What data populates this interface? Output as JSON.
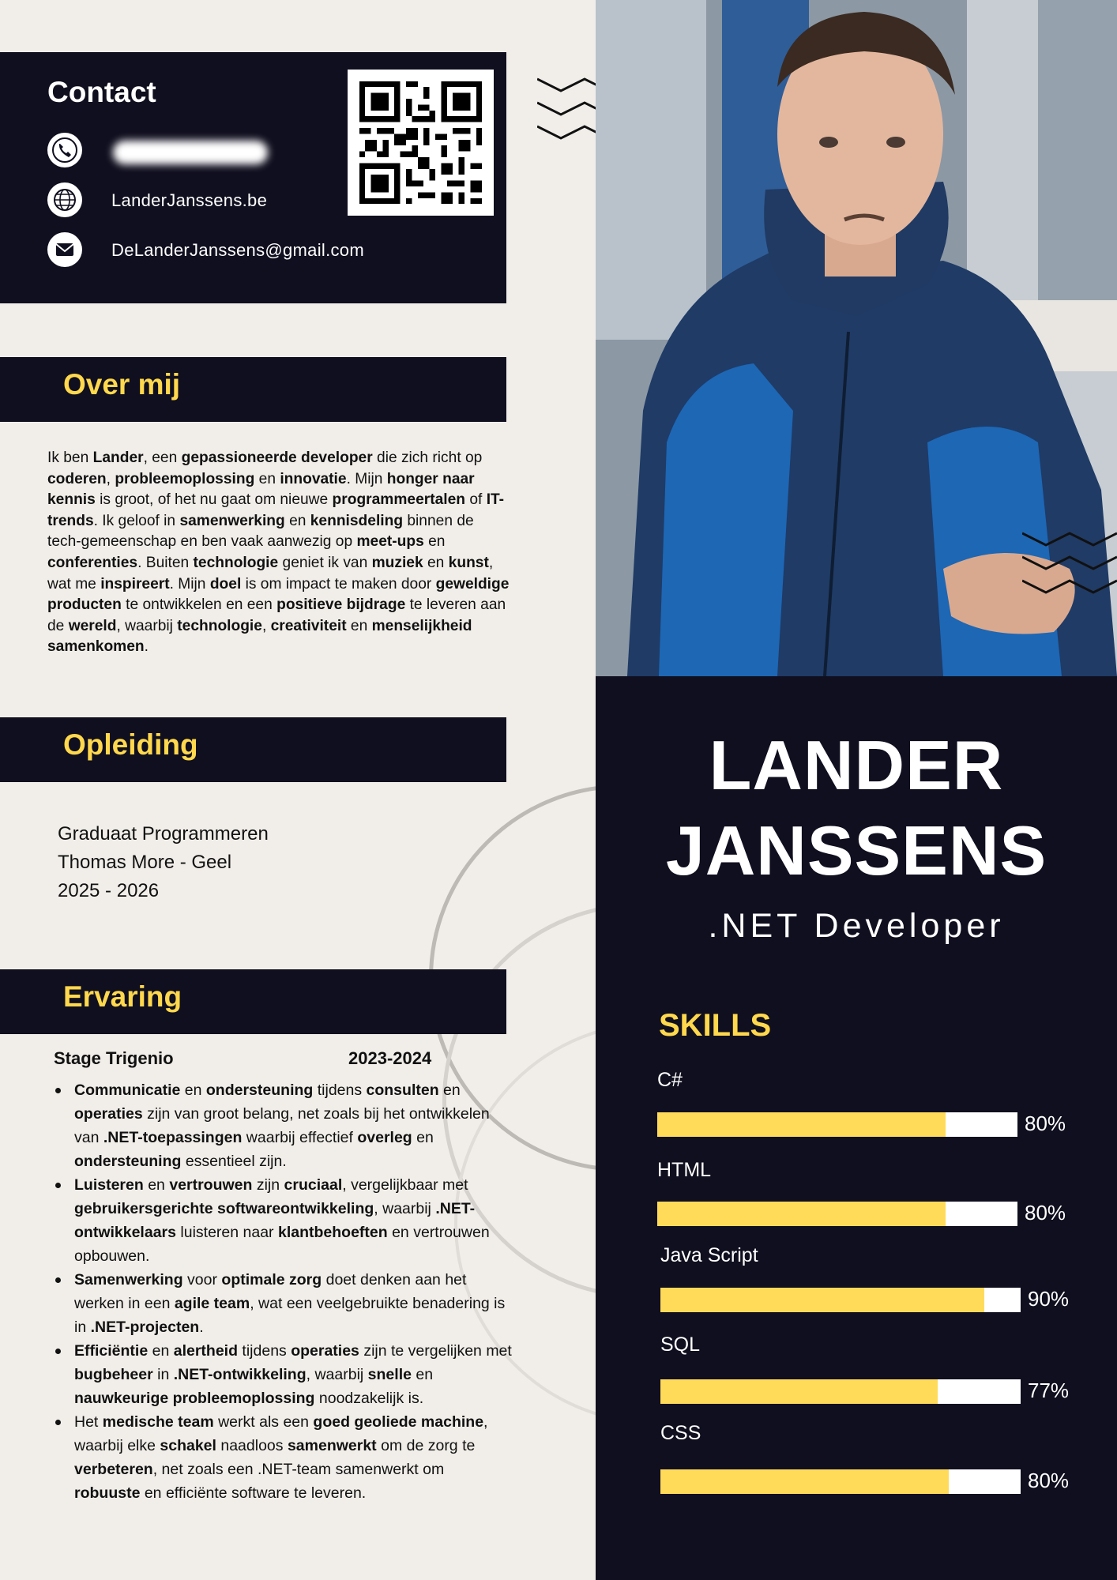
{
  "contact": {
    "title": "Contact",
    "website": "LanderJanssens.be",
    "email": "DeLanderJanssens@gmail.com"
  },
  "about": {
    "title": "Over mij",
    "text_parts": [
      {
        "t": "Ik ben ",
        "b": false
      },
      {
        "t": "Lander",
        "b": true
      },
      {
        "t": ", een ",
        "b": false
      },
      {
        "t": "gepassioneerde developer",
        "b": true
      },
      {
        "t": " die zich richt op ",
        "b": false
      },
      {
        "t": "coderen",
        "b": true
      },
      {
        "t": ", ",
        "b": false
      },
      {
        "t": "probleemoplossing",
        "b": true
      },
      {
        "t": " en ",
        "b": false
      },
      {
        "t": "innovatie",
        "b": true
      },
      {
        "t": ". Mijn ",
        "b": false
      },
      {
        "t": "honger naar kennis",
        "b": true
      },
      {
        "t": " is groot, of het nu gaat om nieuwe ",
        "b": false
      },
      {
        "t": "programmeertalen",
        "b": true
      },
      {
        "t": " of ",
        "b": false
      },
      {
        "t": "IT-trends",
        "b": true
      },
      {
        "t": ". Ik geloof in ",
        "b": false
      },
      {
        "t": "samenwerking",
        "b": true
      },
      {
        "t": " en ",
        "b": false
      },
      {
        "t": "kennisdeling",
        "b": true
      },
      {
        "t": " binnen de tech-gemeenschap en ben vaak aanwezig op ",
        "b": false
      },
      {
        "t": "meet-ups",
        "b": true
      },
      {
        "t": " en ",
        "b": false
      },
      {
        "t": "conferenties",
        "b": true
      },
      {
        "t": ". Buiten ",
        "b": false
      },
      {
        "t": "technologie",
        "b": true
      },
      {
        "t": " geniet ik van ",
        "b": false
      },
      {
        "t": "muziek",
        "b": true
      },
      {
        "t": " en ",
        "b": false
      },
      {
        "t": "kunst",
        "b": true
      },
      {
        "t": ", wat me ",
        "b": false
      },
      {
        "t": "inspireert",
        "b": true
      },
      {
        "t": ". Mijn ",
        "b": false
      },
      {
        "t": "doel",
        "b": true
      },
      {
        "t": " is om impact te maken door ",
        "b": false
      },
      {
        "t": "geweldige producten",
        "b": true
      },
      {
        "t": " te ontwikkelen en een ",
        "b": false
      },
      {
        "t": "positieve bijdrage",
        "b": true
      },
      {
        "t": " te leveren aan de ",
        "b": false
      },
      {
        "t": "wereld",
        "b": true
      },
      {
        "t": ", waarbij ",
        "b": false
      },
      {
        "t": "technologie",
        "b": true
      },
      {
        "t": ", ",
        "b": false
      },
      {
        "t": "creativiteit",
        "b": true
      },
      {
        "t": " en ",
        "b": false
      },
      {
        "t": "menselijkheid samenkomen",
        "b": true
      },
      {
        "t": ".",
        "b": false
      }
    ]
  },
  "education": {
    "title": "Opleiding",
    "program": "Graduaat Programmeren",
    "school": "Thomas More - Geel",
    "years": "2025 - 2026"
  },
  "experience": {
    "title": "Ervaring",
    "role": "Stage Trigenio",
    "years": "2023-2024",
    "bullets": [
      [
        {
          "t": "Communicatie",
          "b": true
        },
        {
          "t": " en ",
          "b": false
        },
        {
          "t": "ondersteuning",
          "b": true
        },
        {
          "t": " tijdens ",
          "b": false
        },
        {
          "t": "consulten",
          "b": true
        },
        {
          "t": " en ",
          "b": false
        },
        {
          "t": "operaties",
          "b": true
        },
        {
          "t": " zijn van groot belang, net zoals bij het ontwikkelen van ",
          "b": false
        },
        {
          "t": ".NET-toepassingen",
          "b": true
        },
        {
          "t": " waarbij effectief ",
          "b": false
        },
        {
          "t": "overleg",
          "b": true
        },
        {
          "t": " en ",
          "b": false
        },
        {
          "t": "ondersteuning",
          "b": true
        },
        {
          "t": " essentieel zijn.",
          "b": false
        }
      ],
      [
        {
          "t": "Luisteren",
          "b": true
        },
        {
          "t": " en ",
          "b": false
        },
        {
          "t": "vertrouwen",
          "b": true
        },
        {
          "t": " zijn ",
          "b": false
        },
        {
          "t": "cruciaal",
          "b": true
        },
        {
          "t": ", vergelijkbaar met ",
          "b": false
        },
        {
          "t": "gebruikersgerichte softwareontwikkeling",
          "b": true
        },
        {
          "t": ", waarbij ",
          "b": false
        },
        {
          "t": ".NET-ontwikkelaars",
          "b": true
        },
        {
          "t": " luisteren naar ",
          "b": false
        },
        {
          "t": "klantbehoeften",
          "b": true
        },
        {
          "t": " en vertrouwen opbouwen.",
          "b": false
        }
      ],
      [
        {
          "t": "Samenwerking",
          "b": true
        },
        {
          "t": " voor ",
          "b": false
        },
        {
          "t": "optimale zorg",
          "b": true
        },
        {
          "t": " doet denken aan het werken in een ",
          "b": false
        },
        {
          "t": "agile team",
          "b": true
        },
        {
          "t": ", wat een veelgebruikte benadering is in ",
          "b": false
        },
        {
          "t": ".NET-projecten",
          "b": true
        },
        {
          "t": ".",
          "b": false
        }
      ],
      [
        {
          "t": "Efficiëntie",
          "b": true
        },
        {
          "t": " en ",
          "b": false
        },
        {
          "t": "alertheid",
          "b": true
        },
        {
          "t": " tijdens ",
          "b": false
        },
        {
          "t": "operaties",
          "b": true
        },
        {
          "t": " zijn te vergelijken met ",
          "b": false
        },
        {
          "t": "bugbeheer",
          "b": true
        },
        {
          "t": " in ",
          "b": false
        },
        {
          "t": ".NET-ontwikkeling",
          "b": true
        },
        {
          "t": ", waarbij ",
          "b": false
        },
        {
          "t": "snelle",
          "b": true
        },
        {
          "t": " en ",
          "b": false
        },
        {
          "t": "nauwkeurige probleemoplossing",
          "b": true
        },
        {
          "t": " noodzakelijk is.",
          "b": false
        }
      ],
      [
        {
          "t": "Het ",
          "b": false
        },
        {
          "t": "medische team",
          "b": true
        },
        {
          "t": " werkt als een ",
          "b": false
        },
        {
          "t": "goed geoliede machine",
          "b": true
        },
        {
          "t": ", waarbij elke ",
          "b": false
        },
        {
          "t": "schakel",
          "b": true
        },
        {
          "t": " naadloos ",
          "b": false
        },
        {
          "t": "samenwerkt",
          "b": true
        },
        {
          "t": " om de zorg te ",
          "b": false
        },
        {
          "t": "verbeteren",
          "b": true
        },
        {
          "t": ", net zoals een .NET-team samenwerkt om ",
          "b": false
        },
        {
          "t": "robuuste",
          "b": true
        },
        {
          "t": " en efficiënte software te leveren.",
          "b": false
        }
      ]
    ]
  },
  "profile": {
    "first_name": "LANDER",
    "last_name": "JANSSENS",
    "role": ".NET Developer"
  },
  "skills": {
    "title": "SKILLS",
    "items": [
      {
        "name": "C#",
        "percent": 80,
        "label": "80%"
      },
      {
        "name": "HTML",
        "percent": 80,
        "label": "80%"
      },
      {
        "name": "Java Script",
        "percent": 90,
        "label": "90%"
      },
      {
        "name": "SQL",
        "percent": 77,
        "label": "77%"
      },
      {
        "name": "CSS",
        "percent": 80,
        "label": "80%"
      }
    ]
  },
  "colors": {
    "navy": "#100f1f",
    "accent_yellow": "#ffd84d",
    "background": "#f1eee9"
  },
  "icons": [
    "phone-icon",
    "globe-icon",
    "mail-icon",
    "qr-code"
  ]
}
